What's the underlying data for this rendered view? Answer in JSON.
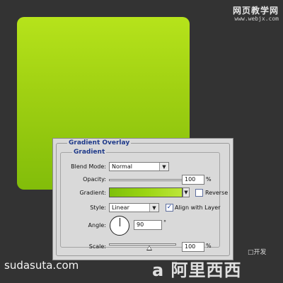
{
  "watermarks": {
    "top_title": "网页教学网",
    "top_url": "www.webjx.com",
    "bottom_left": "sudasuta.com",
    "bottom_right": "a 阿里西西",
    "small": "□开发"
  },
  "colors": {
    "canvas_bg": "#333333",
    "swatch_top": "#b6e31b",
    "swatch_bottom": "#82bd0a",
    "panel_bg": "#d9d9d9",
    "legend_blue": "#1f3a8a"
  },
  "panel": {
    "outer_title": "Gradient Overlay",
    "inner_title": "Gradient",
    "blend_mode_label": "Blend Mode:",
    "blend_mode_value": "Normal",
    "opacity_label": "Opacity:",
    "opacity_value": "100",
    "opacity_percent": 100,
    "opacity_unit": "%",
    "gradient_label": "Gradient:",
    "reverse_label": "Reverse",
    "reverse_checked": false,
    "style_label": "Style:",
    "style_value": "Linear",
    "align_label": "Align with Layer",
    "align_checked": true,
    "angle_label": "Angle:",
    "angle_value": "90",
    "angle_unit": "°",
    "scale_label": "Scale:",
    "scale_value": "100",
    "scale_percent": 100,
    "scale_unit": "%"
  }
}
